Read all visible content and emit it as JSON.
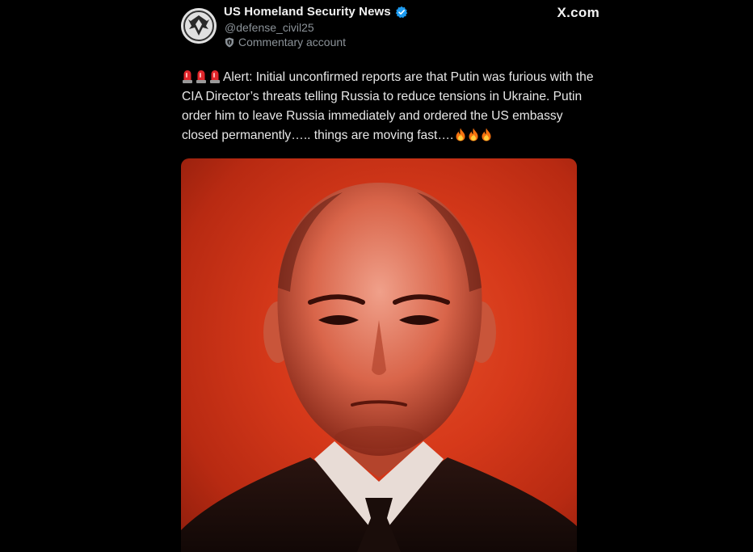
{
  "post": {
    "display_name": "US Homeland Security News",
    "handle": "@defense_civil25",
    "account_type": "Commentary account",
    "brand": "X.com",
    "text": "Alert: Initial unconfirmed reports are that Putin was furious with the CIA Director’s threats telling Russia to reduce tensions in Ukraine. Putin order him to leave Russia immediately and ordered the US embassy closed permanently….. things are moving fast….",
    "leading_emoji": [
      "siren-emoji",
      "siren-emoji",
      "siren-emoji"
    ],
    "trailing_emoji": [
      "fire-emoji",
      "fire-emoji",
      "fire-emoji"
    ]
  },
  "colors": {
    "background": "#000000",
    "verified": "#1d9bf0",
    "secondary_text": "#8b9298",
    "image_tint": "#d6391a"
  },
  "media": {
    "description": "portrait photo with red tint",
    "icon": "photo"
  }
}
